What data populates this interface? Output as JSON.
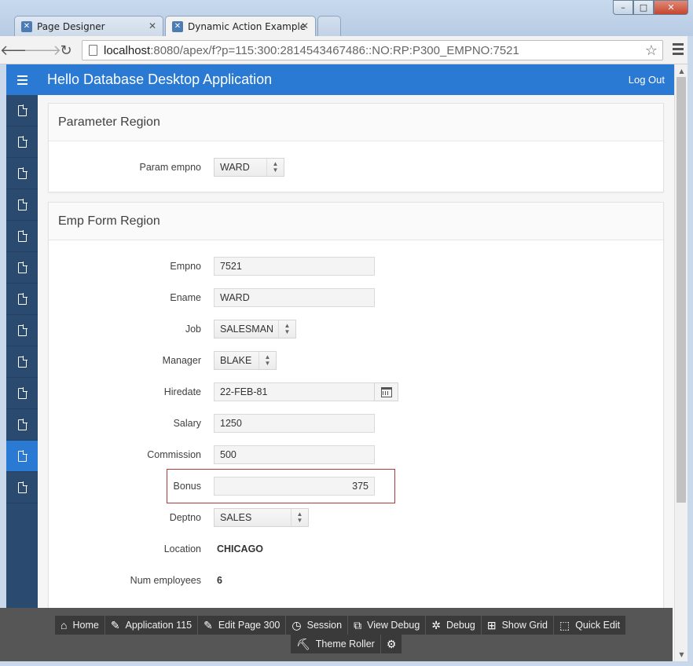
{
  "browser": {
    "tabs": [
      {
        "label": "Page Designer",
        "active": false
      },
      {
        "label": "Dynamic Action Example",
        "active": true
      }
    ],
    "url_host": "localhost",
    "url_rest": ":8080/apex/f?p=115:300:2814543467486::NO:RP:P300_EMPNO:7521",
    "window_buttons": {
      "minimize": "–",
      "maximize": "□",
      "close": "✕"
    },
    "icons": [
      "back-arrow-icon",
      "forward-arrow-icon",
      "reload-icon",
      "page-icon",
      "star-icon",
      "menu-icon"
    ]
  },
  "app": {
    "title": "Hello Database Desktop Application",
    "logout_label": "Log Out",
    "accent_color": "#2a79d3",
    "sidebar_items": 13,
    "sidebar_active_index": 11
  },
  "parameter_region": {
    "title": "Parameter Region",
    "param_empno": {
      "label": "Param empno",
      "value": "WARD"
    }
  },
  "emp_form": {
    "title": "Emp Form Region",
    "empno": {
      "label": "Empno",
      "value": "7521"
    },
    "ename": {
      "label": "Ename",
      "value": "WARD"
    },
    "job": {
      "label": "Job",
      "value": "SALESMAN"
    },
    "manager": {
      "label": "Manager",
      "value": "BLAKE"
    },
    "hiredate": {
      "label": "Hiredate",
      "value": "22-FEB-81"
    },
    "salary": {
      "label": "Salary",
      "value": "1250"
    },
    "commission": {
      "label": "Commission",
      "value": "500"
    },
    "bonus": {
      "label": "Bonus",
      "value": "375"
    },
    "deptno": {
      "label": "Deptno",
      "value": "SALES"
    },
    "location": {
      "label": "Location",
      "value": "CHICAGO"
    },
    "num_employees": {
      "label": "Num employees",
      "value": "6"
    }
  },
  "dev_toolbar": {
    "home": "Home",
    "application": "Application 115",
    "edit_page": "Edit Page 300",
    "session": "Session",
    "view_debug": "View Debug",
    "debug": "Debug",
    "show_grid": "Show Grid",
    "quick_edit": "Quick Edit",
    "theme_roller": "Theme Roller"
  }
}
